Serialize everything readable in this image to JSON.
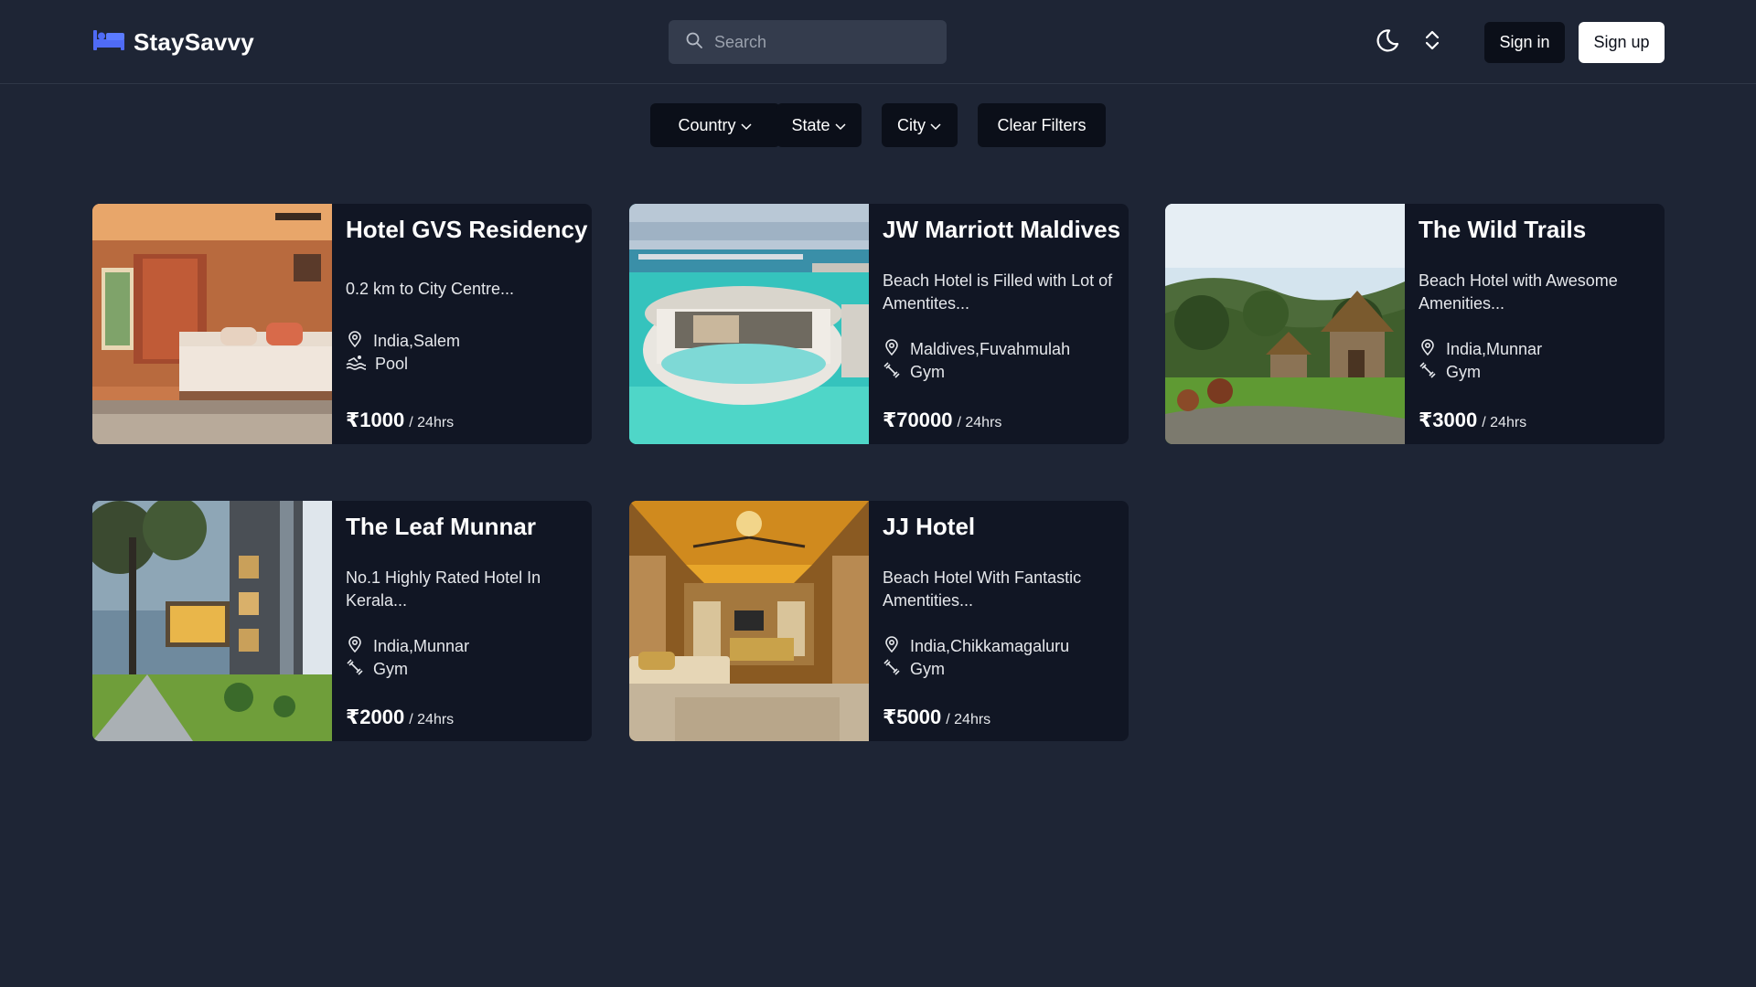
{
  "header": {
    "brand": "StaySavvy",
    "search_placeholder": "Search",
    "signin_label": "Sign in",
    "signup_label": "Sign up",
    "icons": [
      "bed-icon",
      "search-icon",
      "moon-icon",
      "chevrons-up-down-icon"
    ]
  },
  "filters": {
    "country_label": "Country",
    "state_label": "State",
    "city_label": "City",
    "clear_label": "Clear Filters"
  },
  "hotels": [
    {
      "name": "Hotel GVS Residency",
      "description": "0.2 km to City Centre...",
      "location": "India,Salem",
      "amenity": "Pool",
      "amenity_icon": "pool-icon",
      "price": "₹1000",
      "per": "/ 24hrs"
    },
    {
      "name": "JW Marriott Maldives",
      "description": "Beach Hotel is Filled with Lot of Amentites...",
      "location": "Maldives,Fuvahmulah",
      "amenity": "Gym",
      "amenity_icon": "dumbbell-icon",
      "price": "₹70000",
      "per": "/ 24hrs"
    },
    {
      "name": "The Wild Trails",
      "description": "Beach Hotel with Awesome Amenities...",
      "location": "India,Munnar",
      "amenity": "Gym",
      "amenity_icon": "dumbbell-icon",
      "price": "₹3000",
      "per": "/ 24hrs"
    },
    {
      "name": "The Leaf Munnar",
      "description": "No.1 Highly Rated Hotel In Kerala...",
      "location": "India,Munnar",
      "amenity": "Gym",
      "amenity_icon": "dumbbell-icon",
      "price": "₹2000",
      "per": "/ 24hrs"
    },
    {
      "name": "JJ Hotel",
      "description": "Beach Hotel With Fantastic Amentities...",
      "location": "India,Chikkamagaluru",
      "amenity": "Gym",
      "amenity_icon": "dumbbell-icon",
      "price": "₹5000",
      "per": "/ 24hrs"
    }
  ],
  "colors": {
    "background": "#1e2535",
    "card": "#111624",
    "brand_accent": "#4f6bf5",
    "button_dark": "#0b0f19"
  }
}
